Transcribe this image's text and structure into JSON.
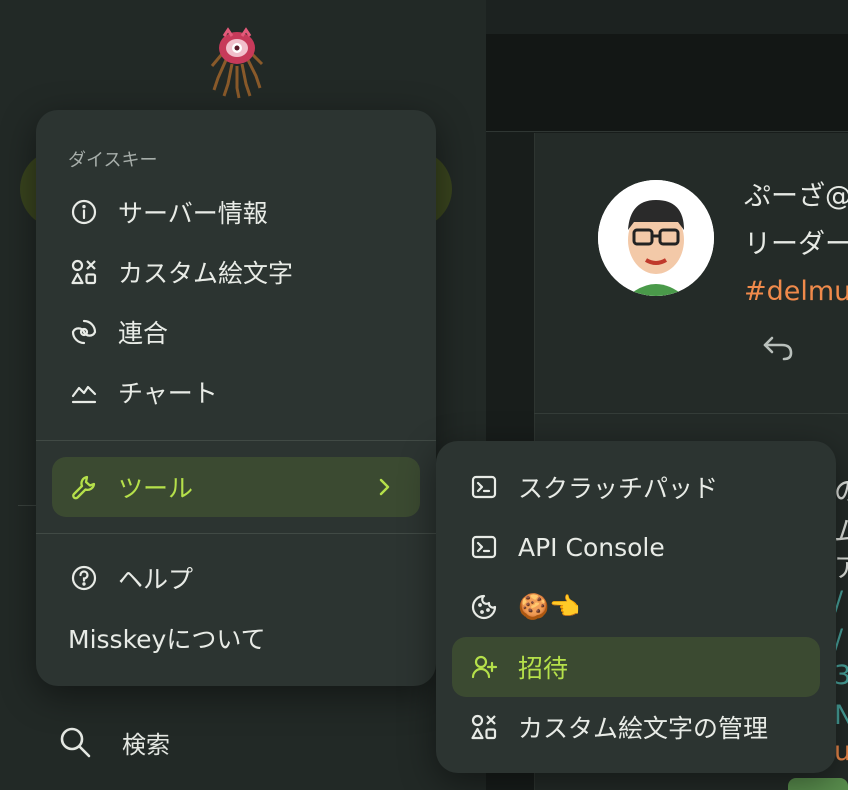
{
  "background": {
    "search_label": "検索",
    "note": {
      "name": "ぷーざ@",
      "subtitle": "リーダー",
      "hashtag": "#delmu"
    },
    "peek_fragments": [
      "の",
      "ム",
      "ア",
      "/",
      "/",
      "3",
      "N",
      "u"
    ]
  },
  "main_menu": {
    "caption": "ダイスキー",
    "items": [
      {
        "label": "サーバー情報",
        "icon": "info-icon"
      },
      {
        "label": "カスタム絵文字",
        "icon": "shapes-icon"
      },
      {
        "label": "連合",
        "icon": "federation-icon"
      },
      {
        "label": "チャート",
        "icon": "chart-icon"
      },
      {
        "label": "ツール",
        "icon": "wrench-icon",
        "active": true
      },
      {
        "label": "ヘルプ",
        "icon": "help-icon"
      },
      {
        "label": "Misskeyについて"
      }
    ]
  },
  "tools_submenu": {
    "items": [
      {
        "label": "スクラッチパッド",
        "icon": "terminal-icon"
      },
      {
        "label": "API Console",
        "icon": "terminal-icon"
      },
      {
        "label": "🍪👈",
        "icon": "cookie-icon"
      },
      {
        "label": "招待",
        "icon": "user-plus-icon",
        "active": true
      },
      {
        "label": "カスタム絵文字の管理",
        "icon": "shapes-icon"
      }
    ]
  },
  "colors": {
    "accent": "#b5e04a",
    "active_bg": "#3b4a31",
    "menu_bg": "#2c3431",
    "hashtag": "#f08a4b"
  }
}
